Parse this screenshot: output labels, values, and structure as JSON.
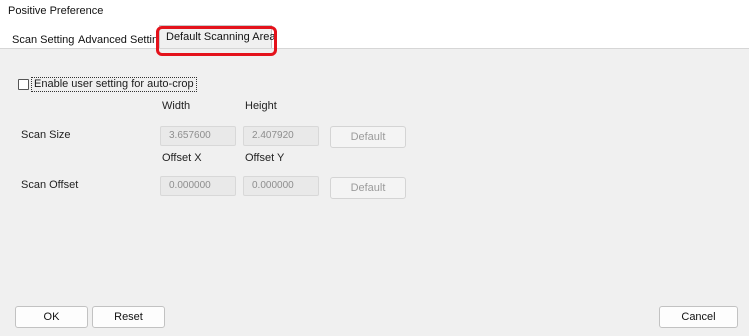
{
  "window": {
    "title": "Positive Preference"
  },
  "tabs": [
    {
      "label": "Scan Setting"
    },
    {
      "label": "Advanced Setting"
    },
    {
      "label": "Default Scanning Area"
    }
  ],
  "auto_crop": {
    "label": "Enable user setting for auto-crop",
    "checked": false
  },
  "scan_size": {
    "label": "Scan Size",
    "col1_header": "Width",
    "col2_header": "Height",
    "width_value": "3.657600",
    "height_value": "2.407920",
    "default_label": "Default"
  },
  "scan_offset": {
    "label": "Scan Offset",
    "col1_header": "Offset X",
    "col2_header": "Offset Y",
    "x_value": "0.000000",
    "y_value": "0.000000",
    "default_label": "Default"
  },
  "footer": {
    "ok_label": "OK",
    "reset_label": "Reset",
    "cancel_label": "Cancel"
  },
  "colors": {
    "highlight": "#e4121b",
    "background": "#f0f0f0"
  }
}
